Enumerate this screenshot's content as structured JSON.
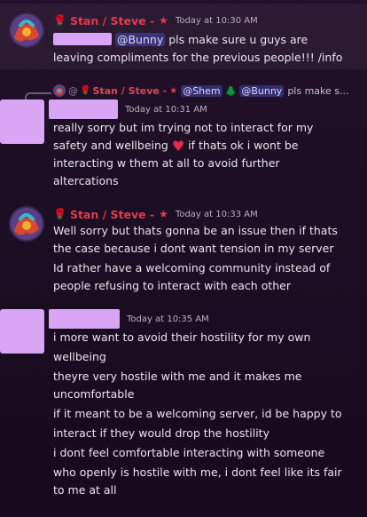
{
  "messages": [
    {
      "username": "Stan / Steve -",
      "rose": "🌹",
      "star": "★",
      "timestamp": "Today at 10:30 AM",
      "mention": "@Bunny",
      "lines": [
        "pls make sure u guys are",
        "leaving compliments for the previous people!!! /info"
      ]
    },
    {
      "reply": {
        "prefix": "@",
        "username": "Stan / Steve -",
        "star": "★",
        "mention1": "@Shem",
        "mention2": "@Bunny",
        "tree": "🌲",
        "preview": "pls make s..."
      },
      "timestamp": "Today at 10:31 AM",
      "lines": [
        "really sorry but im trying not to interact for my",
        "safety and wellbeing",
        "if thats ok i wont be",
        "interacting w them at all to avoid further",
        "altercations"
      ],
      "heart": "♥"
    },
    {
      "username": "Stan / Steve -",
      "rose": "🌹",
      "star": "★",
      "timestamp": "Today at 10:33 AM",
      "lines": [
        "Well sorry but thats gonna be an issue then if thats",
        "the case because i dont want tension in my server",
        "Id rather have a welcoming community instead of",
        "people refusing to interact with each other"
      ]
    },
    {
      "timestamp": "Today at 10:35 AM",
      "lines": [
        "i more want to avoid their hostility for my own",
        "wellbeing",
        "theyre very hostile with me and it makes me",
        "uncomfortable",
        "if it meant to be a welcoming server, id be happy to",
        "interact if they would drop the hostility",
        "i dont feel comfortable interacting with someone",
        "who openly is hostile with me, i dont feel like its fair",
        "to me at all"
      ]
    }
  ],
  "colors": {
    "username": "#e23b4c",
    "redaction": "#d8a6f4",
    "mention_bg": "#5865f2"
  }
}
